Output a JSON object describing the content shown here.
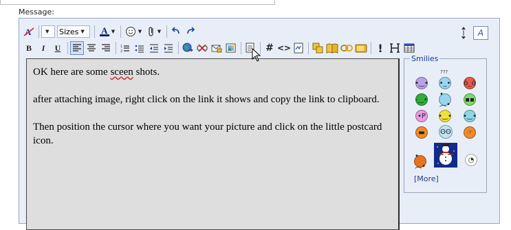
{
  "message_label": "Message:",
  "toolbar": {
    "font_dropdown_value": "",
    "size_dropdown_value": "Sizes",
    "text_color_label": "A",
    "buttons_row1": [
      "remove-formatting",
      "font-select",
      "size-select",
      "text-color",
      "smilies",
      "attach",
      "undo",
      "redo"
    ],
    "buttons_row2": [
      "bold",
      "italic",
      "underline",
      "align-left",
      "align-center",
      "align-right",
      "ordered-list",
      "unordered-list",
      "outdent",
      "indent",
      "insert-link",
      "remove-link",
      "insert-email",
      "insert-image",
      "quote",
      "code-hash",
      "html-code",
      "php-code",
      "copy",
      "book",
      "link-chain",
      "insert-flash",
      "exclamation",
      "heading",
      "table"
    ],
    "bold_label": "B",
    "italic_label": "I",
    "underline_label": "U",
    "hash_label": "#",
    "code_label": "<>",
    "mode_label": "A"
  },
  "editor_text": {
    "p1": "OK here are some",
    "p1_misspelled": "sceen",
    "p1_end": "shots.",
    "p2": "after attaching image, right click on the link it shows and copy the link to clipboard.",
    "p3": "Then position the cursor where you want your picture and click on the little postcard icon."
  },
  "smilies": {
    "legend": "Smilies",
    "more_label": "[More]",
    "tiny_label": "???",
    "items": [
      "smile-purple",
      "confused-blue",
      "angry-red",
      "wink-green",
      "frown-blue",
      "grin-green",
      "tongue-pink",
      "smile-yellow",
      "smile-teal",
      "cool-orange",
      "shocked",
      "pointing",
      "sad-orange",
      "snowman",
      "bomb"
    ]
  },
  "colors": {
    "editor_bg": "#e8eef7",
    "textarea_bg": "#dedede",
    "link_blue": "#1b3a8c",
    "spell_red": "#e02020"
  }
}
